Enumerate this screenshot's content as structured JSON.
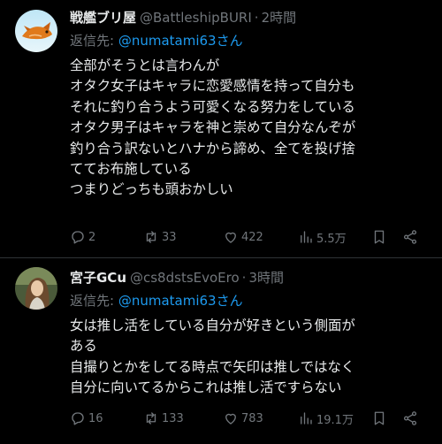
{
  "tweets": [
    {
      "author_name": "戦艦ブリ屋",
      "handle": "@BattleshipBURI",
      "separator": "·",
      "time": "2時間",
      "reply_prefix": "返信先: ",
      "reply_to": "@numatami63さん",
      "lines": [
        "全部がそうとは言わんが",
        "オタク女子はキャラに恋愛感情を持って自分も",
        "それに釣り合うよう可愛くなる努力をしている",
        "オタク男子はキャラを神と崇めて自分なんぞが",
        "釣り合う訳ないとハナから諦め、全てを投げ捨",
        "ててお布施している",
        "つまりどっちも頭おかしい"
      ],
      "replies": "2",
      "retweets": "33",
      "likes": "422",
      "views": "5.5万"
    },
    {
      "author_name": "宮子GCu",
      "handle": "@cs8dstsEvoEro",
      "separator": "·",
      "time": "3時間",
      "reply_prefix": "返信先: ",
      "reply_to": "@numatami63さん",
      "lines": [
        "女は推し活をしている自分が好きという側面が",
        "ある",
        "自撮りとかをしてる時点で矢印は推しではなく",
        "自分に向いてるからこれは推し活ですらない"
      ],
      "replies": "16",
      "retweets": "133",
      "likes": "783",
      "views": "19.1万"
    }
  ],
  "colors": {
    "background": "#000000",
    "text": "#e7e9ea",
    "muted": "#71767b",
    "accent": "#1d9bf0",
    "divider": "#2f3336"
  },
  "icons": {
    "reply": "reply-icon",
    "retweet": "retweet-icon",
    "like": "heart-icon",
    "views": "views-icon",
    "bookmark": "bookmark-icon",
    "share": "share-icon"
  }
}
